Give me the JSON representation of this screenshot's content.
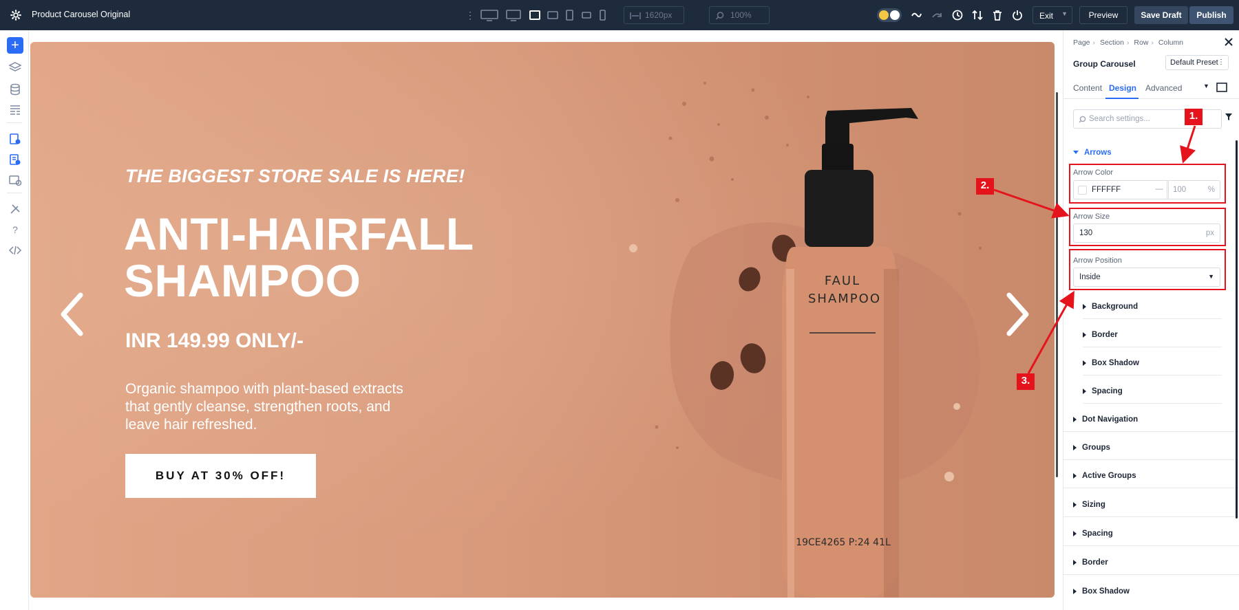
{
  "topbar": {
    "title": "Product Carousel Original",
    "width_value": "1620px",
    "zoom_value": "100%",
    "exit_label": "Exit",
    "preview_label": "Preview",
    "save_draft_label": "Save Draft",
    "publish_label": "Publish"
  },
  "banner": {
    "kicker": "THE BIGGEST STORE SALE IS HERE!",
    "headline_line1": "ANTI-HAIRFALL",
    "headline_line2": "SHAMPOO",
    "price": "INR 149.99 ONLY/-",
    "description": "Organic shampoo with plant-based extracts that gently cleanse, strengthen roots, and leave hair refreshed.",
    "cta_label": "BUY AT 30% OFF!",
    "bottle_label_line1": "FAUL",
    "bottle_label_line2": "SHAMPOO",
    "bottle_code": "19CE4265 P:24 41L"
  },
  "panel": {
    "breadcrumb": [
      "Page",
      "Section",
      "Row",
      "Column"
    ],
    "module_title": "Group Carousel",
    "preset_label": "Default Preset",
    "tabs": [
      "Content",
      "Design",
      "Advanced"
    ],
    "active_tab": "Design",
    "search_placeholder": "Search settings...",
    "arrows_section": "Arrows",
    "arrow_color_label": "Arrow Color",
    "arrow_color_value": "FFFFFF",
    "arrow_opacity_value": "100",
    "arrow_opacity_unit": "%",
    "arrow_size_label": "Arrow Size",
    "arrow_size_value": "130",
    "arrow_size_unit": "px",
    "arrow_position_label": "Arrow Position",
    "arrow_position_value": "Inside",
    "arrow_subsections": [
      "Background",
      "Border",
      "Box Shadow",
      "Spacing"
    ],
    "sections": [
      "Dot Navigation",
      "Groups",
      "Active Groups",
      "Sizing",
      "Spacing",
      "Border",
      "Box Shadow"
    ]
  },
  "annotations": [
    "1.",
    "2.",
    "3."
  ],
  "colors": {
    "accent": "#2a6cf6",
    "topbar_bg": "#1e2b3c",
    "annotation_red": "#e5141c",
    "banner_bg": "#d89a7b"
  }
}
